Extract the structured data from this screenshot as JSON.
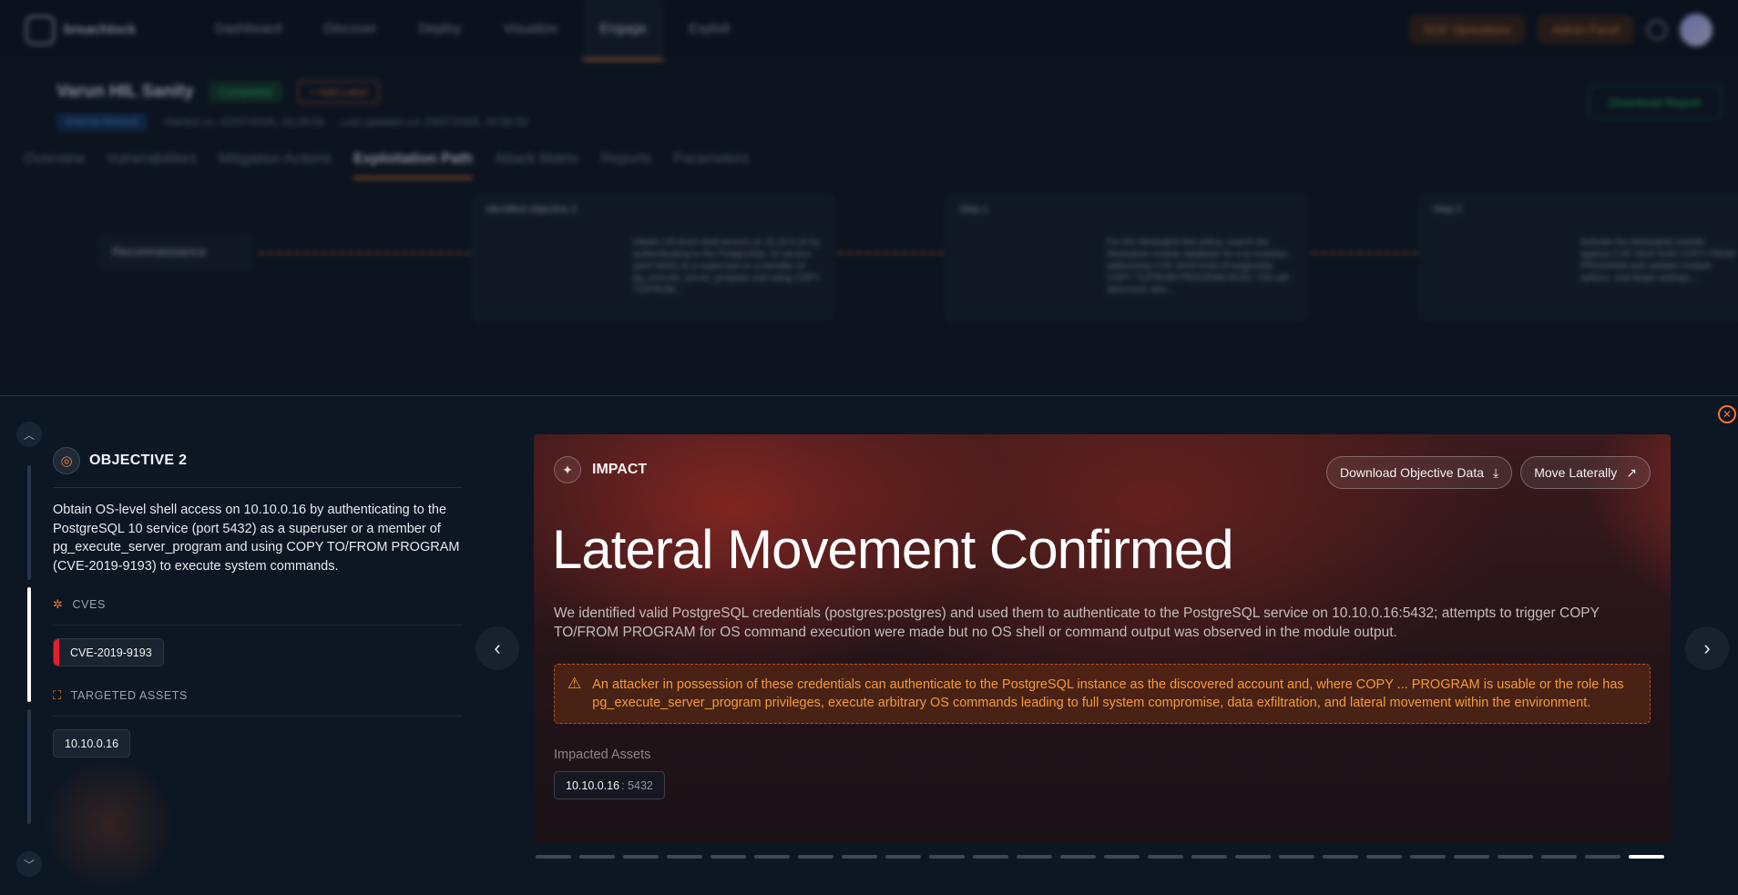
{
  "topnav": {
    "logo_text": "breachlock",
    "items": [
      "Dashboard",
      "Discover",
      "Deploy",
      "Visualize",
      "Engage",
      "Exploit"
    ],
    "active_index": 4,
    "right_buttons": [
      "SOC Operations",
      "Admin Panel"
    ]
  },
  "scenario": {
    "title": "Varun HIL Sanity",
    "status": "Completed",
    "add_label": "+ Add Label",
    "network_badge": "Internal Network",
    "started": "Started on: 02/07/2025, 16:28:03",
    "updated": "Last updated on: 03/07/2025, 20:50:02",
    "download_report": "Download Report",
    "tabs": [
      "Overview",
      "Vulnerabilities",
      "Mitigation Actions",
      "Exploitation Path",
      "Attack Matrix",
      "Reports",
      "Parameters"
    ],
    "active_tab_index": 3
  },
  "flow": {
    "recon_label": "Reconnaissance",
    "nodes": [
      {
        "title": "Identified objective 2",
        "text": "Obtain OS-level shell access on 10.10.0.16 by authenticating to the PostgreSQL 10 service (port 5432) as a superuser or a member of pg_execute_server_program and using COPY TO/FROM..."
      },
      {
        "title": "Step 1",
        "text": "For the Metasploit this policy, search the Metasploit module database for a ly modules addressing CVE-2019-9193 (PostgreSQL COPY TO/FROM PROGRAM RCE). This will determine whe..."
      },
      {
        "title": "Step 2",
        "text": "Activate the Metasploit module against CVE-2019-9193 COPY FROM PROGRAM and validate module options, and target settings..."
      }
    ]
  },
  "objective": {
    "title": "OBJECTIVE 2",
    "description": "Obtain OS-level shell access on 10.10.0.16 by authenticating to the PostgreSQL 10 service (port 5432) as a superuser or a member of pg_execute_server_program and using COPY TO/FROM PROGRAM (CVE-2019-9193) to execute system commands.",
    "cves_heading": "CVES",
    "cves": [
      "CVE-2019-9193"
    ],
    "assets_heading": "TARGETED ASSETS",
    "assets": [
      "10.10.0.16"
    ]
  },
  "impact": {
    "label": "IMPACT",
    "download_button": "Download Objective Data",
    "move_button": "Move Laterally",
    "headline": "Lateral Movement Confirmed",
    "description": "We identified valid PostgreSQL credentials (postgres:postgres) and used them to authenticate to the PostgreSQL service on 10.10.0.16:5432; attempts to trigger COPY TO/FROM PROGRAM for OS command execution were made but no OS shell or command output was observed in the module output.",
    "warning": "An attacker in possession of these credentials can authenticate to the PostgreSQL instance as the discovered account and, where COPY ... PROGRAM is usable or the role has pg_execute_server_program privileges, execute arbitrary OS commands leading to full system compromise, data exfiltration, and lateral movement within the environment.",
    "impacted_label": "Impacted Assets",
    "impacted_asset": {
      "host": "10.10.0.16",
      "port": ": 5432"
    }
  },
  "pagination": {
    "total": 26,
    "active_index": 25
  },
  "colors": {
    "accent": "#f07a2c",
    "danger": "#e5202e",
    "warning": "#f59a3c",
    "success": "#2ed46f"
  },
  "icons": {
    "objective": "target-icon",
    "cves": "bug-icon",
    "assets": "scan-target-icon",
    "impact": "sparkle-icon",
    "download": "download-icon",
    "move": "arrow-up-right-icon",
    "warning": "warning-triangle-icon",
    "close": "close-icon"
  }
}
